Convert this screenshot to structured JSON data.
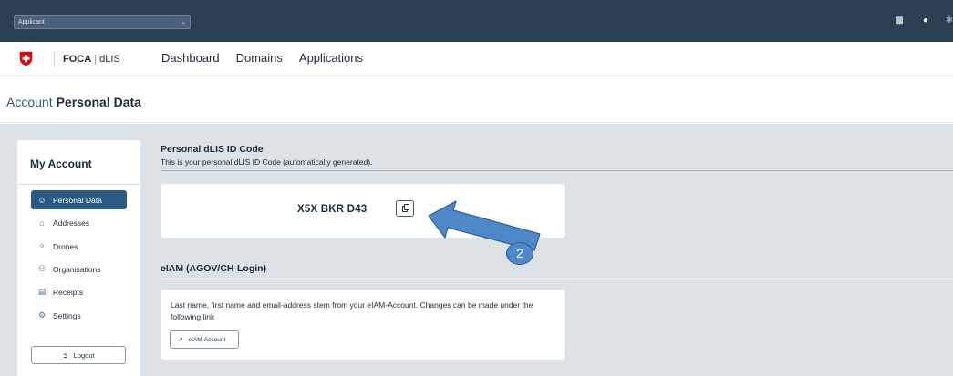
{
  "topbar": {
    "role_select_value": "Applicant",
    "icons": [
      "help-icon",
      "user-icon",
      "settings-icon"
    ]
  },
  "header": {
    "brand_bold": "FOCA",
    "brand_sep": "|",
    "brand_rest": "dLIS",
    "nav": [
      "Dashboard",
      "Domains",
      "Applications"
    ]
  },
  "page": {
    "breadcrumb": "Account",
    "title": "Personal Data"
  },
  "sidebar": {
    "title": "My Account",
    "items": [
      {
        "label": "Personal Data",
        "icon": "user-icon",
        "active": true
      },
      {
        "label": "Addresses",
        "icon": "home-icon",
        "active": false
      },
      {
        "label": "Drones",
        "icon": "drone-icon",
        "active": false
      },
      {
        "label": "Organisations",
        "icon": "people-icon",
        "active": false
      },
      {
        "label": "Receipts",
        "icon": "receipt-icon",
        "active": false
      },
      {
        "label": "Settings",
        "icon": "gear-icon",
        "active": false
      }
    ],
    "logout_label": "Logout"
  },
  "id_section": {
    "title": "Personal dLIS ID Code",
    "description": "This is your personal dLIS ID Code (automatically generated).",
    "code": "X5X BKR D43"
  },
  "eiam_section": {
    "title": "eIAM (AGOV/CH-Login)",
    "text": "Last name, first name and email-address stem from your eIAM-Account. Changes can be made under the following link",
    "button_label": "eIAM-Account"
  },
  "annotation": {
    "number": "2"
  },
  "colors": {
    "topbar": "#2b3f52",
    "accent": "#2b5a82",
    "swiss_red": "#e3000f",
    "main_bg": "#dde2e7",
    "annotation": "#4f88c9"
  }
}
